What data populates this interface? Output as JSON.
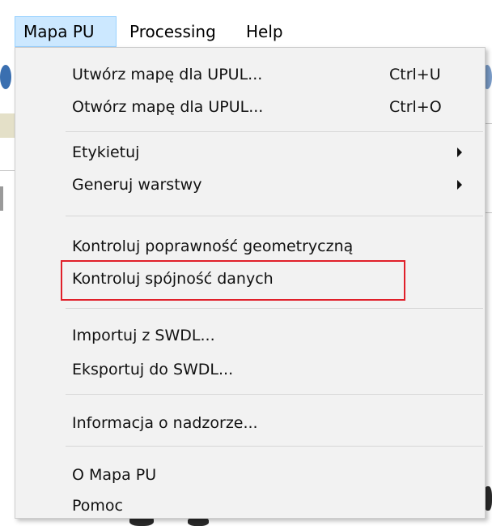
{
  "menubar": {
    "items": [
      {
        "label": "Mapa PU",
        "active": true
      },
      {
        "label": "Processing",
        "active": false
      },
      {
        "label": "Help",
        "active": false
      }
    ]
  },
  "dropdown": {
    "groups": [
      [
        {
          "label": "Utwórz mapę dla UPUL...",
          "shortcut": "Ctrl+U"
        },
        {
          "label": "Otwórz mapę dla UPUL...",
          "shortcut": "Ctrl+O"
        }
      ],
      [
        {
          "label": "Etykietuj",
          "submenu": true
        },
        {
          "label": "Generuj warstwy",
          "submenu": true
        }
      ],
      [
        {
          "label": "Kontroluj poprawność geometryczną"
        },
        {
          "label": "Kontroluj spójność danych",
          "highlighted": true
        }
      ],
      [
        {
          "label": "Importuj z SWDL..."
        },
        {
          "label": "Eksportuj do SWDL..."
        }
      ],
      [
        {
          "label": "Informacja o nadzorze..."
        }
      ],
      [
        {
          "label": "O Mapa PU"
        },
        {
          "label": "Pomoc"
        }
      ]
    ]
  },
  "colors": {
    "menubar_active_bg": "#cce8ff",
    "menu_bg": "#f2f2f2",
    "highlight_border": "#e0202a"
  }
}
